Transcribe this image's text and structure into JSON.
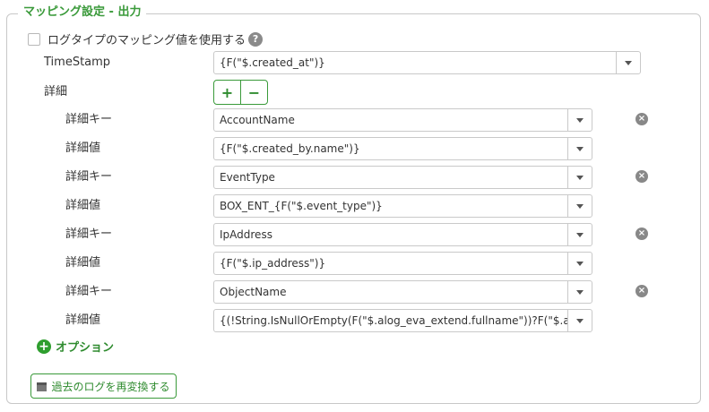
{
  "section": {
    "legend": "マッピング設定 - 出力"
  },
  "use_log_type": {
    "label": "ログタイプのマッピング値を使用する",
    "checked": false,
    "help": "?"
  },
  "timestamp": {
    "label": "TimeStamp",
    "value": "{F(\"$.created_at\")}"
  },
  "details": {
    "label": "詳細",
    "add": "+",
    "remove": "−",
    "remove_icon": "×",
    "key_label": "詳細キー",
    "value_label": "詳細値",
    "items": [
      {
        "key": "AccountName",
        "value": "{F(\"$.created_by.name\")}"
      },
      {
        "key": "EventType",
        "value": "BOX_ENT_{F(\"$.event_type\")}"
      },
      {
        "key": "IpAddress",
        "value": "{F(\"$.ip_address\")}"
      },
      {
        "key": "ObjectName",
        "value": "{(!String.IsNullOrEmpty(F(\"$.alog_eva_extend.fullname\"))?F(\"$.alog_e"
      }
    ]
  },
  "option": {
    "label": "オプション"
  },
  "reconvert": {
    "label": "過去のログを再変換する"
  },
  "colors": {
    "accent": "#3a9a3a",
    "border": "#c8c8c8",
    "text": "#333333",
    "icon_gray": "#888888"
  }
}
